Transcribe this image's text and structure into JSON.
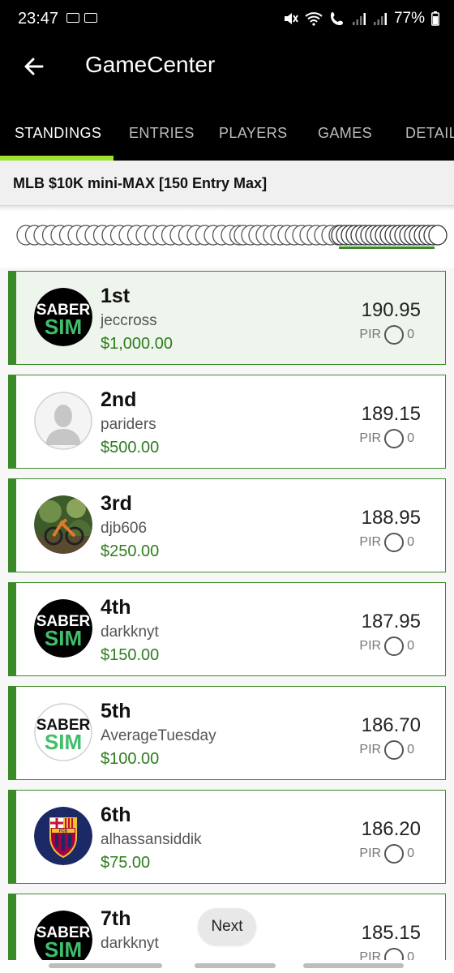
{
  "status_bar": {
    "time": "23:47",
    "battery": "77%",
    "icons": [
      "mute-icon",
      "wifi-icon",
      "wifi-call-icon",
      "signal-icon",
      "signal-icon",
      "battery-icon"
    ]
  },
  "app_bar": {
    "title": "GameCenter",
    "back_icon": "arrow-left-icon"
  },
  "tabs": [
    {
      "label": "STANDINGS",
      "active": true
    },
    {
      "label": "ENTRIES",
      "active": false
    },
    {
      "label": "PLAYERS",
      "active": false
    },
    {
      "label": "GAMES",
      "active": false
    },
    {
      "label": "DETAIL",
      "active": false
    }
  ],
  "contest": {
    "title": "MLB $10K mini-MAX [150 Entry Max]"
  },
  "standings": [
    {
      "rank": "1st",
      "username": "jeccross",
      "prize": "$1,000.00",
      "score": "190.95",
      "pir_label": "PIR",
      "pir_value": "0",
      "avatar": "sabersim-logo"
    },
    {
      "rank": "2nd",
      "username": "pariders",
      "prize": "$500.00",
      "score": "189.15",
      "pir_label": "PIR",
      "pir_value": "0",
      "avatar": "default-user"
    },
    {
      "rank": "3rd",
      "username": "djb606",
      "prize": "$250.00",
      "score": "188.95",
      "pir_label": "PIR",
      "pir_value": "0",
      "avatar": "bike-photo"
    },
    {
      "rank": "4th",
      "username": "darkknyt",
      "prize": "$150.00",
      "score": "187.95",
      "pir_label": "PIR",
      "pir_value": "0",
      "avatar": "sabersim-logo"
    },
    {
      "rank": "5th",
      "username": "AverageTuesday",
      "prize": "$100.00",
      "score": "186.70",
      "pir_label": "PIR",
      "pir_value": "0",
      "avatar": "sabersim-logo-light"
    },
    {
      "rank": "6th",
      "username": "alhassansiddik",
      "prize": "$75.00",
      "score": "186.20",
      "pir_label": "PIR",
      "pir_value": "0",
      "avatar": "fcb-crest"
    },
    {
      "rank": "7th",
      "username": "darkknyt",
      "prize": "",
      "score": "185.15",
      "pir_label": "PIR",
      "pir_value": "0",
      "avatar": "sabersim-logo"
    }
  ],
  "pagination": {
    "next_label": "Next"
  },
  "logo_text": {
    "saber": "SABER",
    "sim": "SIM",
    "fcb": "FCB"
  },
  "colors": {
    "accent": "#9be32e",
    "card_border": "#3a8a28",
    "prize": "#2e7d1e",
    "sim_green": "#3fbf6a",
    "header_bg": "#000000"
  }
}
